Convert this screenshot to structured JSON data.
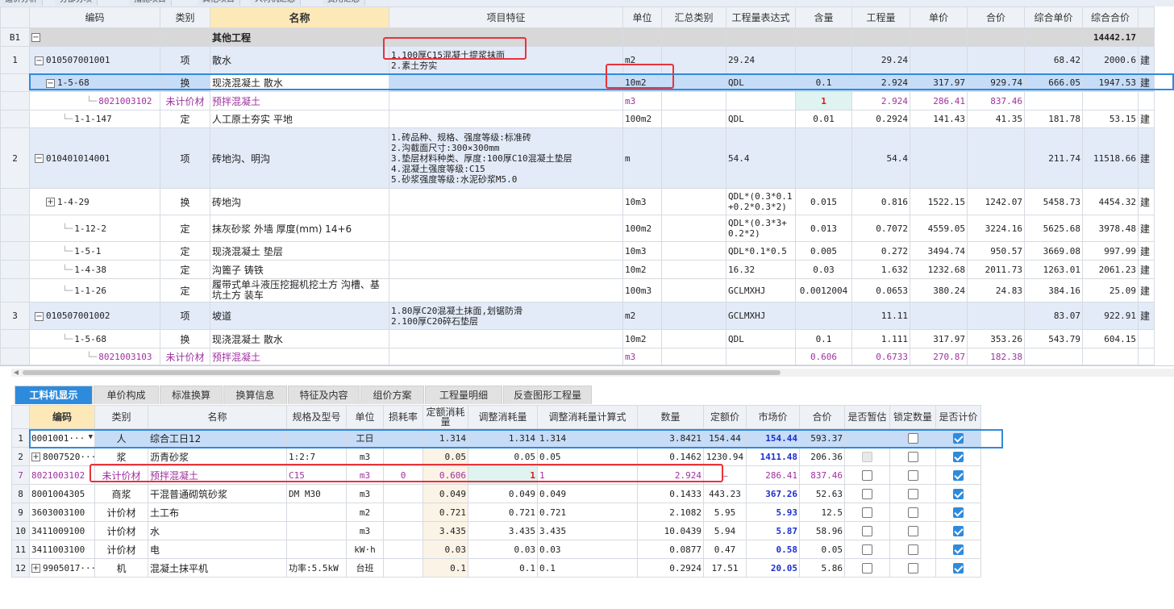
{
  "top_tabs": [
    "造价分析",
    "分部分项",
    "措施项目",
    "其他项目",
    "人材机汇总",
    "费用汇总"
  ],
  "upper": {
    "headers": [
      "",
      "编码",
      "类别",
      "名称",
      "项目特征",
      "单位",
      "汇总类别",
      "工程量表达式",
      "含量",
      "工程量",
      "单价",
      "合价",
      "综合单价",
      "综合合价"
    ],
    "rows": [
      {
        "idx": "B1",
        "code": "",
        "type": "",
        "name": "其他工程",
        "feature": "",
        "unit": "",
        "summary": "",
        "expr": "",
        "content": "",
        "qty": "",
        "price": "",
        "total": "",
        "cprice": "",
        "ctotal": "14442.17"
      },
      {
        "idx": "1",
        "code": "010507001001",
        "type": "项",
        "name": "散水",
        "feature": "1.100厚C15混凝土提浆抹面\n2.素土夯实",
        "unit": "m2",
        "summary": "",
        "expr": "29.24",
        "content": "",
        "qty": "29.24",
        "price": "",
        "total": "",
        "cprice": "68.42",
        "ctotal": "2000.6"
      },
      {
        "idx": "",
        "code": "1-5-68",
        "type": "换",
        "name": "现浇混凝土 散水",
        "feature": "",
        "unit": "10m2",
        "summary": "",
        "expr": "QDL",
        "content": "0.1",
        "qty": "2.924",
        "price": "317.97",
        "total": "929.74",
        "cprice": "666.05",
        "ctotal": "1947.53"
      },
      {
        "idx": "",
        "code": "8021003102",
        "type": "未计价材",
        "name": "预拌混凝土",
        "feature": "",
        "unit": "m3",
        "summary": "",
        "expr": "",
        "content": "1",
        "qty": "2.924",
        "price": "286.41",
        "total": "837.46",
        "cprice": "",
        "ctotal": ""
      },
      {
        "idx": "",
        "code": "1-1-147",
        "type": "定",
        "name": "人工原土夯实 平地",
        "feature": "",
        "unit": "100m2",
        "summary": "",
        "expr": "QDL",
        "content": "0.01",
        "qty": "0.2924",
        "price": "141.43",
        "total": "41.35",
        "cprice": "181.78",
        "ctotal": "53.15"
      },
      {
        "idx": "2",
        "code": "010401014001",
        "type": "项",
        "name": "砖地沟、明沟",
        "feature": "1.砖品种、规格、强度等级:标准砖\n2.沟截面尺寸:300×300mm\n3.垫层材料种类、厚度:100厚C10混凝土垫层\n4.混凝土强度等级:C15\n5.砂浆强度等级:水泥砂浆M5.0",
        "unit": "m",
        "summary": "",
        "expr": "54.4",
        "content": "",
        "qty": "54.4",
        "price": "",
        "total": "",
        "cprice": "211.74",
        "ctotal": "11518.66"
      },
      {
        "idx": "",
        "code": "1-4-29",
        "type": "换",
        "name": "砖地沟",
        "feature": "",
        "unit": "10m3",
        "summary": "",
        "expr": "QDL*(0.3*0.1+0.2*0.3*2)",
        "content": "0.015",
        "qty": "0.816",
        "price": "1522.15",
        "total": "1242.07",
        "cprice": "5458.73",
        "ctotal": "4454.32"
      },
      {
        "idx": "",
        "code": "1-12-2",
        "type": "定",
        "name": "抹灰砂浆 外墙 厚度(mm) 14+6",
        "feature": "",
        "unit": "100m2",
        "summary": "",
        "expr": "QDL*(0.3*3+0.2*2)",
        "content": "0.013",
        "qty": "0.7072",
        "price": "4559.05",
        "total": "3224.16",
        "cprice": "5625.68",
        "ctotal": "3978.48"
      },
      {
        "idx": "",
        "code": "1-5-1",
        "type": "定",
        "name": "现浇混凝土 垫层",
        "feature": "",
        "unit": "10m3",
        "summary": "",
        "expr": "QDL*0.1*0.5",
        "content": "0.005",
        "qty": "0.272",
        "price": "3494.74",
        "total": "950.57",
        "cprice": "3669.08",
        "ctotal": "997.99"
      },
      {
        "idx": "",
        "code": "1-4-38",
        "type": "定",
        "name": "沟篦子 铸铁",
        "feature": "",
        "unit": "10m2",
        "summary": "",
        "expr": "16.32",
        "content": "0.03",
        "qty": "1.632",
        "price": "1232.68",
        "total": "2011.73",
        "cprice": "1263.01",
        "ctotal": "2061.23"
      },
      {
        "idx": "",
        "code": "1-1-26",
        "type": "定",
        "name": "履带式单斗液压挖掘机挖土方 沟槽、基坑土方 装车",
        "feature": "",
        "unit": "100m3",
        "summary": "",
        "expr": "GCLMXHJ",
        "content": "0.0012004",
        "qty": "0.0653",
        "price": "380.24",
        "total": "24.83",
        "cprice": "384.16",
        "ctotal": "25.09"
      },
      {
        "idx": "3",
        "code": "010507001002",
        "type": "项",
        "name": "坡道",
        "feature": "1.80厚C20混凝土抹面,划锯防滑\n2.100厚C20碎石垫层",
        "unit": "m2",
        "summary": "",
        "expr": "GCLMXHJ",
        "content": "",
        "qty": "11.11",
        "price": "",
        "total": "",
        "cprice": "83.07",
        "ctotal": "922.91"
      },
      {
        "idx": "",
        "code": "1-5-68",
        "type": "换",
        "name": "现浇混凝土 散水",
        "feature": "",
        "unit": "10m2",
        "summary": "",
        "expr": "QDL",
        "content": "0.1",
        "qty": "1.111",
        "price": "317.97",
        "total": "353.26",
        "cprice": "543.79",
        "ctotal": "604.15"
      },
      {
        "idx": "",
        "code": "8021003103",
        "type": "未计价材",
        "name": "预拌混凝土",
        "feature": "",
        "unit": "m3",
        "summary": "",
        "expr": "",
        "content": "0.606",
        "qty": "0.6733",
        "price": "270.87",
        "total": "182.38",
        "cprice": "",
        "ctotal": ""
      }
    ],
    "right_chars": [
      "建",
      "建",
      "",
      "建",
      "建",
      "建",
      "建",
      "建",
      "建",
      "建",
      "建",
      ""
    ]
  },
  "tabs": [
    "工料机显示",
    "单价构成",
    "标准换算",
    "换算信息",
    "特征及内容",
    "组价方案",
    "工程量明细",
    "反查图形工程量"
  ],
  "lower": {
    "headers": [
      "",
      "编码",
      "类别",
      "名称",
      "规格及型号",
      "单位",
      "损耗率",
      "定额消耗量",
      "调整消耗量",
      "调整消耗量计算式",
      "数量",
      "定额价",
      "市场价",
      "合价",
      "是否暂估",
      "锁定数量",
      "是否计价"
    ],
    "rows": [
      {
        "idx": "1",
        "code": "0001001···",
        "type": "人",
        "name": "综合工日12",
        "spec": "",
        "unit": "工日",
        "loss": "",
        "qtyq": "1.314",
        "adj": "1.314",
        "formula": "1.314",
        "num": "3.8421",
        "base": "154.44",
        "market": "154.44",
        "total": "593.37",
        "est": "",
        "lock": false,
        "priced": true
      },
      {
        "idx": "2",
        "code": "8007520···",
        "type": "浆",
        "name": "沥青砂浆",
        "spec": "1:2:7",
        "unit": "m3",
        "loss": "",
        "qtyq": "0.05",
        "adj": "0.05",
        "formula": "0.05",
        "num": "0.1462",
        "base": "1230.94",
        "market": "1411.48",
        "total": "206.36",
        "est": "dis",
        "lock": false,
        "priced": true
      },
      {
        "idx": "7",
        "code": "8021003102",
        "type": "未计价材",
        "name": "预拌混凝土",
        "spec": "C15",
        "unit": "m3",
        "loss": "0",
        "qtyq": "0.606",
        "adj": "1",
        "formula": "1",
        "num": "2.924",
        "base": "—",
        "market": "286.41",
        "total": "837.46",
        "est": "box",
        "lock": false,
        "priced": true
      },
      {
        "idx": "8",
        "code": "8001004305",
        "type": "商浆",
        "name": "干混普通砌筑砂浆",
        "spec": "DM M30",
        "unit": "m3",
        "loss": "",
        "qtyq": "0.049",
        "adj": "0.049",
        "formula": "0.049",
        "num": "0.1433",
        "base": "443.23",
        "market": "367.26",
        "total": "52.63",
        "est": "box",
        "lock": false,
        "priced": true
      },
      {
        "idx": "9",
        "code": "3603003100",
        "type": "计价材",
        "name": "土工布",
        "spec": "",
        "unit": "m2",
        "loss": "",
        "qtyq": "0.721",
        "adj": "0.721",
        "formula": "0.721",
        "num": "2.1082",
        "base": "5.95",
        "market": "5.93",
        "total": "12.5",
        "est": "box",
        "lock": false,
        "priced": true
      },
      {
        "idx": "10",
        "code": "3411009100",
        "type": "计价材",
        "name": "水",
        "spec": "",
        "unit": "m3",
        "loss": "",
        "qtyq": "3.435",
        "adj": "3.435",
        "formula": "3.435",
        "num": "10.0439",
        "base": "5.94",
        "market": "5.87",
        "total": "58.96",
        "est": "box",
        "lock": false,
        "priced": true
      },
      {
        "idx": "11",
        "code": "3411003100",
        "type": "计价材",
        "name": "电",
        "spec": "",
        "unit": "kW·h",
        "loss": "",
        "qtyq": "0.03",
        "adj": "0.03",
        "formula": "0.03",
        "num": "0.0877",
        "base": "0.47",
        "market": "0.58",
        "total": "0.05",
        "est": "box",
        "lock": false,
        "priced": true
      },
      {
        "idx": "12",
        "code": "9905017···",
        "type": "机",
        "name": "混凝土抹平机",
        "spec": "功率:5.5kW",
        "unit": "台班",
        "loss": "",
        "qtyq": "0.1",
        "adj": "0.1",
        "formula": "0.1",
        "num": "0.2924",
        "base": "17.51",
        "market": "20.05",
        "total": "5.86",
        "est": "box",
        "lock": false,
        "priced": true
      }
    ]
  }
}
